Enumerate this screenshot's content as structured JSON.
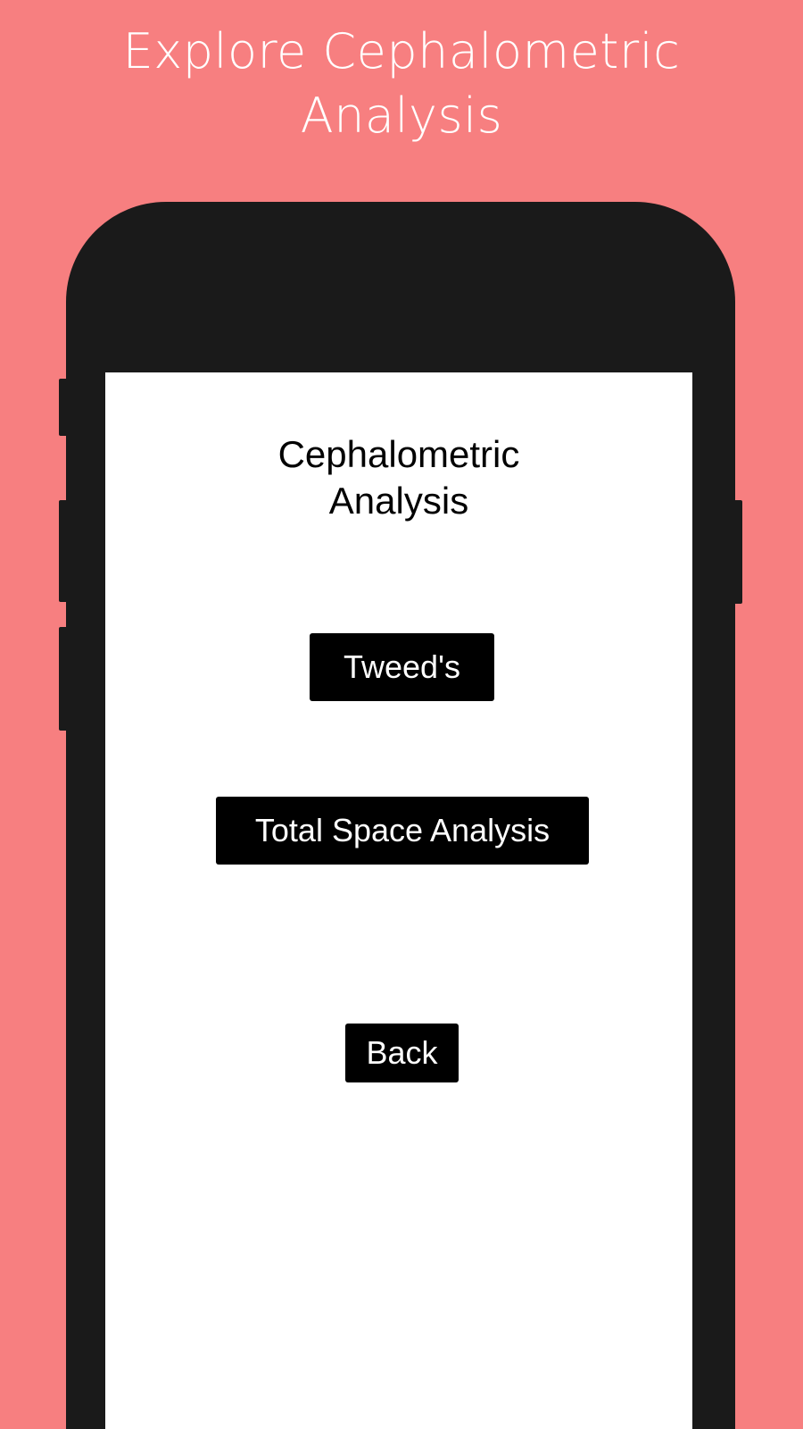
{
  "header": {
    "title_line1": "Explore Cephalometric",
    "title_line2": "Analysis"
  },
  "screen": {
    "title_line1": "Cephalometric",
    "title_line2": "Analysis",
    "buttons": {
      "tweeds": "Tweed's",
      "total_space": "Total Space Analysis",
      "back": "Back"
    }
  },
  "colors": {
    "background": "#f77f80",
    "phone_frame": "#1a1a1a",
    "screen": "#ffffff",
    "button": "#000000"
  }
}
